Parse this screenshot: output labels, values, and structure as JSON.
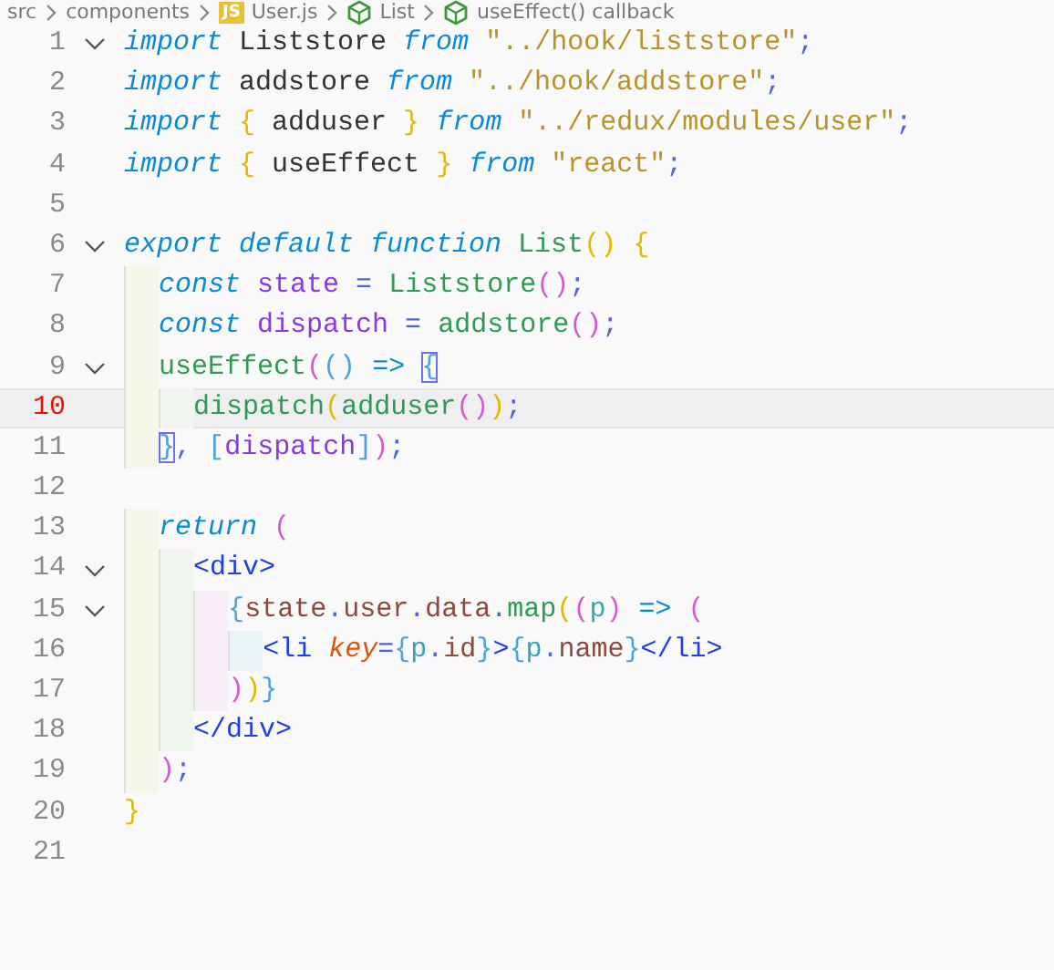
{
  "breadcrumb": [
    {
      "kind": "folder",
      "label": "src"
    },
    {
      "kind": "folder",
      "label": "components"
    },
    {
      "kind": "file",
      "badge": "JS",
      "label": "User.js"
    },
    {
      "kind": "symbol",
      "label": "List"
    },
    {
      "kind": "symbol",
      "label": "useEffect() callback"
    }
  ],
  "lines": [
    {
      "number": "1",
      "expanded": true,
      "current": false,
      "tokens": [
        {
          "kind": "kw",
          "text": "import"
        },
        {
          "kind": "plain",
          "text": " Liststore "
        },
        {
          "kind": "kw",
          "text": "from "
        },
        {
          "kind": "str",
          "text": "\"../hook/liststore\""
        },
        {
          "kind": "punc",
          "text": ";"
        }
      ]
    },
    {
      "number": "2",
      "current": false,
      "tokens": [
        {
          "kind": "kw",
          "text": "import"
        },
        {
          "kind": "plain",
          "text": " addstore "
        },
        {
          "kind": "kw",
          "text": "from "
        },
        {
          "kind": "str",
          "text": "\"../hook/addstore\""
        },
        {
          "kind": "punc",
          "text": ";"
        }
      ]
    },
    {
      "number": "3",
      "current": false,
      "tokens": [
        {
          "kind": "kw",
          "text": "import "
        },
        {
          "kind": "b1",
          "text": "{"
        },
        {
          "kind": "plain",
          "text": " adduser "
        },
        {
          "kind": "b1",
          "text": "} "
        },
        {
          "kind": "kw",
          "text": "from "
        },
        {
          "kind": "str",
          "text": "\"../redux/modules/user\""
        },
        {
          "kind": "punc",
          "text": ";"
        }
      ]
    },
    {
      "number": "4",
      "current": false,
      "tokens": [
        {
          "kind": "kw",
          "text": "import "
        },
        {
          "kind": "b1",
          "text": "{"
        },
        {
          "kind": "plain",
          "text": " useEffect "
        },
        {
          "kind": "b1",
          "text": "} "
        },
        {
          "kind": "kw",
          "text": "from "
        },
        {
          "kind": "str",
          "text": "\"react\""
        },
        {
          "kind": "punc",
          "text": ";"
        }
      ]
    },
    {
      "number": "5",
      "current": false
    },
    {
      "number": "6",
      "expanded": true,
      "current": false,
      "tokens": [
        {
          "kind": "kw",
          "text": "export default function "
        },
        {
          "kind": "fn",
          "text": "List"
        },
        {
          "kind": "b1",
          "text": "() {"
        }
      ]
    },
    {
      "number": "7",
      "current": false,
      "tokens": [
        {
          "kind": "kw",
          "text": "  const "
        },
        {
          "kind": "var",
          "text": "state"
        },
        {
          "kind": "op",
          "text": " = "
        },
        {
          "kind": "fn",
          "text": "Liststore"
        },
        {
          "kind": "b2",
          "text": "()"
        },
        {
          "kind": "punc",
          "text": ";"
        }
      ]
    },
    {
      "number": "8",
      "current": false,
      "tokens": [
        {
          "kind": "kw",
          "text": "  const "
        },
        {
          "kind": "var",
          "text": "dispatch"
        },
        {
          "kind": "op",
          "text": " = "
        },
        {
          "kind": "fn",
          "text": "addstore"
        },
        {
          "kind": "b2",
          "text": "()"
        },
        {
          "kind": "punc",
          "text": ";"
        }
      ]
    },
    {
      "number": "9",
      "expanded": true,
      "current": false,
      "tokens": [
        {
          "kind": "fn",
          "text": "  useEffect"
        },
        {
          "kind": "b2",
          "text": "("
        },
        {
          "kind": "b3",
          "text": "() "
        },
        {
          "kind": "kw2",
          "text": "=> "
        },
        {
          "kind": "b3",
          "text": "{",
          "matched": true
        }
      ]
    },
    {
      "number": "10",
      "current": true,
      "tokens": [
        {
          "kind": "fn",
          "text": "    dispatch"
        },
        {
          "kind": "b1",
          "text": "("
        },
        {
          "kind": "fn",
          "text": "adduser"
        },
        {
          "kind": "b2",
          "text": "()"
        },
        {
          "kind": "b1",
          "text": ")"
        },
        {
          "kind": "punc",
          "text": ";"
        }
      ]
    },
    {
      "number": "11",
      "current": false,
      "tokens": [
        {
          "kind": "b3",
          "text": "  }",
          "matched": true
        },
        {
          "kind": "punc",
          "text": ", "
        },
        {
          "kind": "b3",
          "text": "["
        },
        {
          "kind": "var",
          "text": "dispatch"
        },
        {
          "kind": "b3",
          "text": "]"
        },
        {
          "kind": "b2",
          "text": ")"
        },
        {
          "kind": "punc",
          "text": ";"
        }
      ]
    },
    {
      "number": "12",
      "current": false
    },
    {
      "number": "13",
      "current": false,
      "tokens": [
        {
          "kind": "kw",
          "text": "  return "
        },
        {
          "kind": "b2",
          "text": "("
        }
      ]
    },
    {
      "number": "14",
      "expanded": true,
      "current": false,
      "tokens": [
        {
          "kind": "tag",
          "text": "    <div>"
        }
      ]
    },
    {
      "number": "15",
      "expanded": true,
      "current": false,
      "tokens": [
        {
          "kind": "b3",
          "text": "      {"
        },
        {
          "kind": "prop",
          "text": "state"
        },
        {
          "kind": "punc",
          "text": "."
        },
        {
          "kind": "prop",
          "text": "user"
        },
        {
          "kind": "punc",
          "text": "."
        },
        {
          "kind": "prop",
          "text": "data"
        },
        {
          "kind": "punc",
          "text": "."
        },
        {
          "kind": "fn",
          "text": "map"
        },
        {
          "kind": "b1",
          "text": "("
        },
        {
          "kind": "b2",
          "text": "("
        },
        {
          "kind": "param",
          "text": "p"
        },
        {
          "kind": "b2",
          "text": ") "
        },
        {
          "kind": "kw2",
          "text": "=> "
        },
        {
          "kind": "b2",
          "text": "("
        }
      ]
    },
    {
      "number": "16",
      "current": false,
      "tokens": [
        {
          "kind": "tag",
          "text": "        <li "
        },
        {
          "kind": "attr",
          "text": "key"
        },
        {
          "kind": "op",
          "text": "="
        },
        {
          "kind": "b3",
          "text": "{"
        },
        {
          "kind": "param",
          "text": "p"
        },
        {
          "kind": "punc",
          "text": "."
        },
        {
          "kind": "prop",
          "text": "id"
        },
        {
          "kind": "b3",
          "text": "}"
        },
        {
          "kind": "tag",
          "text": ">"
        },
        {
          "kind": "b3",
          "text": "{"
        },
        {
          "kind": "param",
          "text": "p"
        },
        {
          "kind": "punc",
          "text": "."
        },
        {
          "kind": "prop",
          "text": "name"
        },
        {
          "kind": "b3",
          "text": "}"
        },
        {
          "kind": "tag",
          "text": "</li>"
        }
      ]
    },
    {
      "number": "17",
      "current": false,
      "tokens": [
        {
          "kind": "b2",
          "text": "      )"
        },
        {
          "kind": "b1",
          "text": ")"
        },
        {
          "kind": "b3",
          "text": "}"
        }
      ]
    },
    {
      "number": "18",
      "current": false,
      "tokens": [
        {
          "kind": "tag",
          "text": "    </div>"
        }
      ]
    },
    {
      "number": "19",
      "current": false,
      "tokens": [
        {
          "kind": "b2",
          "text": "  )"
        },
        {
          "kind": "punc",
          "text": ";"
        }
      ]
    },
    {
      "number": "20",
      "current": false,
      "tokens": [
        {
          "kind": "b1",
          "text": "}"
        }
      ]
    },
    {
      "number": "21",
      "current": false
    }
  ]
}
